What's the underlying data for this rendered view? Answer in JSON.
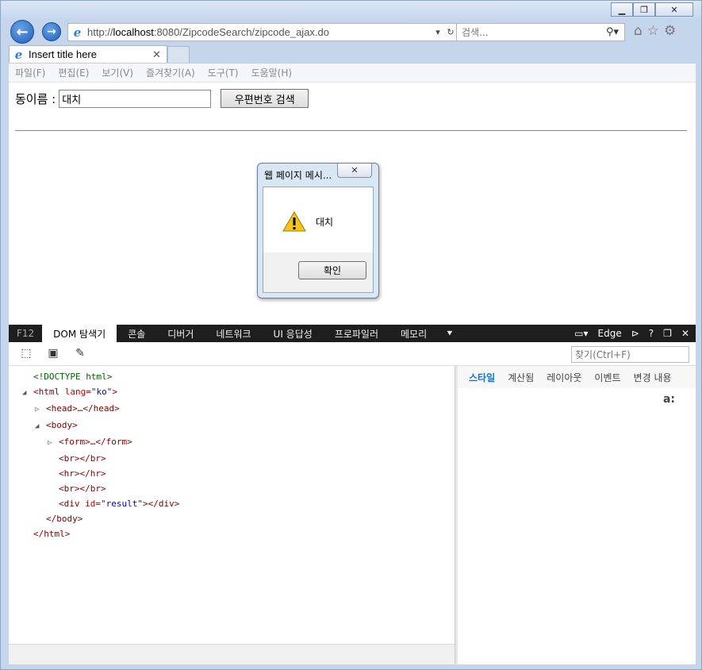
{
  "window": {
    "controls": [
      "minimize",
      "restore",
      "close"
    ]
  },
  "address_bar": {
    "url_prefix": "http://",
    "url_host": "localhost",
    "url_rest": ":8080/ZipcodeSearch/zipcode_ajax.do",
    "dropdown_icon": "chevron-down-icon",
    "refresh_icon": "refresh-icon"
  },
  "search_box": {
    "placeholder": "검색..."
  },
  "tab": {
    "title": "Insert title here",
    "close_glyph": "✕"
  },
  "menu": [
    "파일(F)",
    "편집(E)",
    "보기(V)",
    "즐겨찾기(A)",
    "도구(T)",
    "도움말(H)"
  ],
  "form": {
    "label": "동이름 : ",
    "input_value": "대치",
    "button_label": "우편번호 검색"
  },
  "dialog": {
    "title": "웹 페이지 메시...",
    "message": "대치",
    "ok_label": "확인"
  },
  "devtools": {
    "tabs": [
      "F12",
      "DOM 탐색기",
      "콘솔",
      "디버거",
      "네트워크",
      "UI 응답성",
      "프로파일러",
      "메모리"
    ],
    "active_tab": "DOM 탐색기",
    "emulation_label": "Edge",
    "help": "?",
    "find_placeholder": "찾기(Ctrl+F)",
    "style_tabs": [
      "스타일",
      "계산됨",
      "레이아웃",
      "이벤트",
      "변경 내용"
    ],
    "active_style_tab": "스타일",
    "az_glyph": "a:",
    "dom": {
      "doctype": "<!DOCTYPE html>",
      "html_lang": "ko",
      "result_id": "result"
    }
  },
  "colors": {
    "devtools_bar": "#1e1e1e",
    "accent_blue": "#1a73c9"
  }
}
